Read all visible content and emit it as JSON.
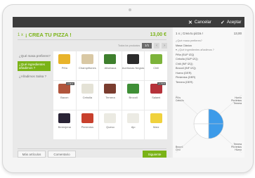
{
  "topbar": {
    "cancel_label": "Cancelar",
    "accept_label": "Aceptar"
  },
  "product": {
    "qty": "1 x",
    "title": "¡ CREA TU PIZZA !",
    "price": "13,00 €"
  },
  "pager": {
    "label": "Todos los productos",
    "page": "1/1",
    "prev": "‹",
    "next": "›"
  },
  "steps": [
    "¿Qué masa prefieres?",
    "¿Qué ingredientes añadimos ?",
    "¿Añadimos Salsa ?"
  ],
  "ingredients": [
    {
      "name": "Piña",
      "color": "#e8b32a",
      "price": ""
    },
    {
      "name": "Champiñones",
      "color": "#d9c8a4",
      "price": ""
    },
    {
      "name": "Albahaca",
      "color": "#3e7f2d",
      "price": ""
    },
    {
      "name": "Aceitunas Negras",
      "color": "#2b2b2b",
      "price": ""
    },
    {
      "name": "Chili",
      "color": "#7cb33a",
      "price": ""
    },
    {
      "name": "Bacon",
      "color": "#b0553c",
      "price": "+1,50 €"
    },
    {
      "name": "Cebolla",
      "color": "#e4e2d6",
      "price": ""
    },
    {
      "name": "Ternera",
      "color": "#7a3d2f",
      "price": ""
    },
    {
      "name": "Brocoli",
      "color": "#3f8f36",
      "price": ""
    },
    {
      "name": "Salami",
      "color": "#b5323a",
      "price": "+1,50 €"
    },
    {
      "name": "Berenjena",
      "color": "#2a2436",
      "price": ""
    },
    {
      "name": "Pimientos",
      "color": "#c8402d",
      "price": ""
    },
    {
      "name": "Queso",
      "color": "#ebeae2",
      "price": ""
    },
    {
      "name": "Ajo",
      "color": "#ecebe4",
      "price": ""
    },
    {
      "name": "Maíz",
      "color": "#f0d23d",
      "price": ""
    }
  ],
  "buttons": {
    "more": "Más artículos",
    "comment": "Comentario",
    "next": "Siguiente"
  },
  "side": {
    "title": "1 x ¡ Crea tu pizza !",
    "price": "13,00",
    "rows": [
      {
        "text": "¿Qué masa prefieres?",
        "secondary": true
      },
      {
        "text": "Masa Clásica",
        "secondary": false
      },
      {
        "text": "▾ ¿Qué ingredientes añadimos ?",
        "secondary": true
      },
      {
        "text": "Piña (SUP IZQ)",
        "secondary": false
      },
      {
        "text": "Cebolla (SUP IZQ)",
        "secondary": false
      },
      {
        "text": "Chili (INF IZQ)",
        "secondary": false
      },
      {
        "text": "Brocoli (INF IZQ)",
        "secondary": false
      },
      {
        "text": "Huevo (DER)",
        "secondary": false
      },
      {
        "text": "Pimientos (DER)",
        "secondary": false
      },
      {
        "text": "Ternera (DER)",
        "secondary": false
      }
    ],
    "pie_labels": {
      "top_left": "Piña\nCebolla",
      "top_right": "Huevo\nPimientos\nTernera",
      "bottom_left": "Brocoli\nChili",
      "bottom_right": "Ternera\nPimientos\nHuevo"
    }
  },
  "colors": {
    "accent": "#7ab317",
    "topbar": "#3c3c3c",
    "pie_selected": "#3d9be9"
  }
}
